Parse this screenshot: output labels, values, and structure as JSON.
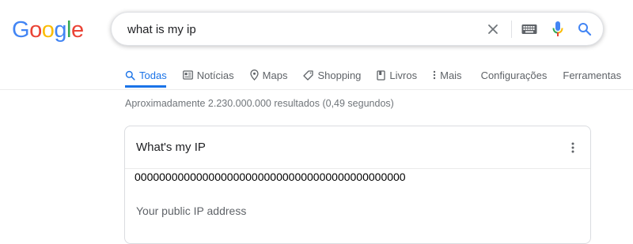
{
  "logo": {
    "letters": [
      {
        "char": "G",
        "color": "#4285F4"
      },
      {
        "char": "o",
        "color": "#EA4335"
      },
      {
        "char": "o",
        "color": "#FBBC05"
      },
      {
        "char": "g",
        "color": "#4285F4"
      },
      {
        "char": "l",
        "color": "#34A853"
      },
      {
        "char": "e",
        "color": "#EA4335"
      }
    ]
  },
  "search": {
    "value": "what is my ip",
    "icons": {
      "clear": "close-icon",
      "keyboard": "keyboard-icon",
      "voice": "mic-icon",
      "search": "search-icon"
    }
  },
  "tabs": [
    {
      "label": "Todas",
      "icon": "search-icon",
      "active": true
    },
    {
      "label": "Notícias",
      "icon": "news-icon"
    },
    {
      "label": "Maps",
      "icon": "map-pin-icon"
    },
    {
      "label": "Shopping",
      "icon": "tag-icon"
    },
    {
      "label": "Livros",
      "icon": "book-icon"
    },
    {
      "label": "Mais",
      "icon": "more-vert-icon"
    },
    {
      "label": "Configurações"
    },
    {
      "label": "Ferramentas"
    }
  ],
  "results": {
    "stats": "Aproximadamente 2.230.000.000 resultados (0,49 segundos)"
  },
  "card": {
    "title": "What's my IP",
    "menu_icon": "more-vert-icon",
    "ip_value": "00000000000000000000000000000000000000000000",
    "subtitle": "Your public IP address"
  },
  "colors": {
    "accent": "#1a73e8",
    "text": "#202124",
    "muted": "#5f6368"
  }
}
